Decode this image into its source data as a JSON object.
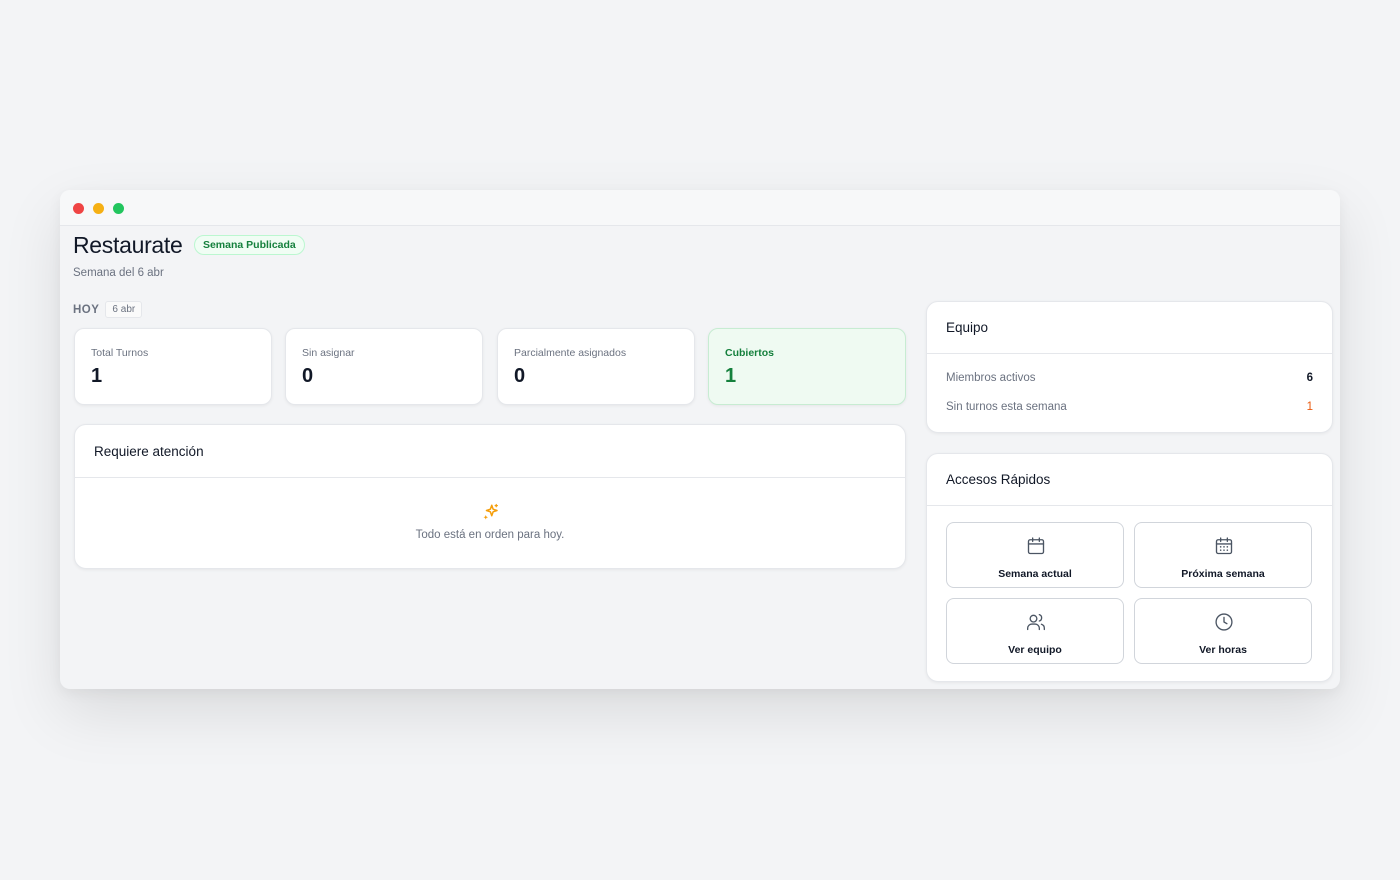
{
  "header": {
    "title": "Restaurate",
    "status_badge": "Semana Publicada",
    "subtitle": "Semana del 6 abr"
  },
  "today": {
    "label": "HOY",
    "date": "6 abr"
  },
  "stats": [
    {
      "label": "Total Turnos",
      "value": "1"
    },
    {
      "label": "Sin asignar",
      "value": "0"
    },
    {
      "label": "Parcialmente asignados",
      "value": "0"
    },
    {
      "label": "Cubiertos",
      "value": "1"
    }
  ],
  "attention": {
    "title": "Requiere atención",
    "icon": "sparkles-icon",
    "empty_message": "Todo está en orden para hoy."
  },
  "team": {
    "title": "Equipo",
    "rows": [
      {
        "label": "Miembros activos",
        "value": "6"
      },
      {
        "label": "Sin turnos esta semana",
        "value": "1"
      }
    ]
  },
  "quick_access": {
    "title": "Accesos Rápidos",
    "buttons": [
      {
        "label": "Semana actual",
        "icon": "calendar-icon"
      },
      {
        "label": "Próxima semana",
        "icon": "calendar-grid-icon"
      },
      {
        "label": "Ver equipo",
        "icon": "users-icon"
      },
      {
        "label": "Ver horas",
        "icon": "clock-icon"
      }
    ]
  },
  "colors": {
    "accent_green": "#15803d",
    "warning_orange": "#ea580c",
    "sparkle_amber": "#f59e0b"
  }
}
